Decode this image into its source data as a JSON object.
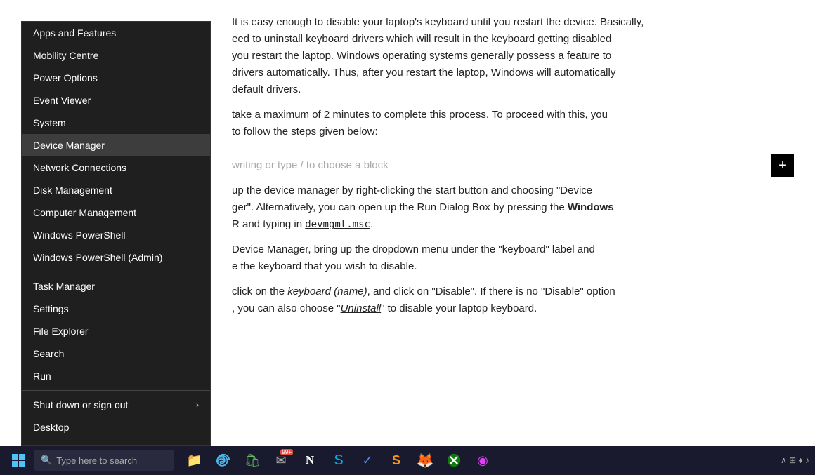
{
  "menu": {
    "items": [
      {
        "id": "apps-features",
        "label": "Apps and Features",
        "arrow": false,
        "active": false,
        "dividerAfter": false
      },
      {
        "id": "mobility-centre",
        "label": "Mobility Centre",
        "arrow": false,
        "active": false,
        "dividerAfter": false
      },
      {
        "id": "power-options",
        "label": "Power Options",
        "arrow": false,
        "active": false,
        "dividerAfter": false
      },
      {
        "id": "event-viewer",
        "label": "Event Viewer",
        "arrow": false,
        "active": false,
        "dividerAfter": false
      },
      {
        "id": "system",
        "label": "System",
        "arrow": false,
        "active": false,
        "dividerAfter": false
      },
      {
        "id": "device-manager",
        "label": "Device Manager",
        "arrow": false,
        "active": true,
        "dividerAfter": false
      },
      {
        "id": "network-connections",
        "label": "Network Connections",
        "arrow": false,
        "active": false,
        "dividerAfter": false
      },
      {
        "id": "disk-management",
        "label": "Disk Management",
        "arrow": false,
        "active": false,
        "dividerAfter": false
      },
      {
        "id": "computer-management",
        "label": "Computer Management",
        "arrow": false,
        "active": false,
        "dividerAfter": false
      },
      {
        "id": "windows-powershell",
        "label": "Windows PowerShell",
        "arrow": false,
        "active": false,
        "dividerAfter": false
      },
      {
        "id": "windows-powershell-admin",
        "label": "Windows PowerShell (Admin)",
        "arrow": false,
        "active": false,
        "dividerAfter": true
      },
      {
        "id": "task-manager",
        "label": "Task Manager",
        "arrow": false,
        "active": false,
        "dividerAfter": false
      },
      {
        "id": "settings",
        "label": "Settings",
        "arrow": false,
        "active": false,
        "dividerAfter": false
      },
      {
        "id": "file-explorer",
        "label": "File Explorer",
        "arrow": false,
        "active": false,
        "dividerAfter": false
      },
      {
        "id": "search",
        "label": "Search",
        "arrow": false,
        "active": false,
        "dividerAfter": false
      },
      {
        "id": "run",
        "label": "Run",
        "arrow": false,
        "active": false,
        "dividerAfter": true
      },
      {
        "id": "shut-down-sign-out",
        "label": "Shut down or sign out",
        "arrow": true,
        "active": false,
        "dividerAfter": false
      },
      {
        "id": "desktop",
        "label": "Desktop",
        "arrow": false,
        "active": false,
        "dividerAfter": false
      }
    ]
  },
  "article": {
    "para1": "It is easy enough to disable your laptop's keyboard until you restart the device. Basically,",
    "para1b": "eed to uninstall keyboard drivers which will result in the keyboard getting disabled",
    "para1c": "you restart the laptop. Windows operating systems generally possess a feature to",
    "para1d": "drivers automatically. Thus, after you restart the laptop, Windows will automatically",
    "para1e": "default drivers.",
    "para2a": "take a maximum of 2 minutes to complete this process. To proceed with this, you",
    "para2b": "to follow the steps given below:",
    "block_placeholder": "writing or type / to choose a block",
    "para3a": "up the device manager by right-clicking the start button and choosing \"Device",
    "para3b": "ger\". Alternatively, you can open up the Run Dialog Box by pressing the",
    "para3c": "Windows",
    "para3d": "R and typing in",
    "code": "devmgmt.msc",
    "para3e": ".",
    "para4a": "Device Manager, bring up the dropdown menu under the \"keyboard\" label and",
    "para4b": "e the keyboard that you wish to disable.",
    "para5a": "click on the",
    "para5b": "keyboard (name)",
    "para5c": ", and click on \"Disable\". If there is no \"Disable\" option",
    "para5d": ", you can also choose \"",
    "para5e": "Uninstall",
    "para5f": "\" to disable your laptop keyboard."
  },
  "taskbar": {
    "search_placeholder": "Type here to search",
    "icons": [
      {
        "id": "explorer",
        "symbol": "📁",
        "label": "File Explorer"
      },
      {
        "id": "edge",
        "symbol": "🌐",
        "label": "Microsoft Edge"
      },
      {
        "id": "store",
        "symbol": "🛍",
        "label": "Microsoft Store"
      },
      {
        "id": "mail-badge",
        "symbol": "✉",
        "badge": "99+",
        "label": "Mail"
      },
      {
        "id": "notion",
        "symbol": "N",
        "label": "Notion"
      },
      {
        "id": "skype",
        "symbol": "S",
        "label": "Skype"
      },
      {
        "id": "todo",
        "symbol": "✓",
        "label": "Microsoft To Do"
      },
      {
        "id": "sublime",
        "symbol": "S",
        "label": "Sublime Text"
      },
      {
        "id": "firefox",
        "symbol": "🦊",
        "label": "Firefox"
      },
      {
        "id": "xbox",
        "symbol": "⊞",
        "label": "Xbox"
      },
      {
        "id": "multi",
        "symbol": "◉",
        "label": "Multi"
      }
    ]
  }
}
